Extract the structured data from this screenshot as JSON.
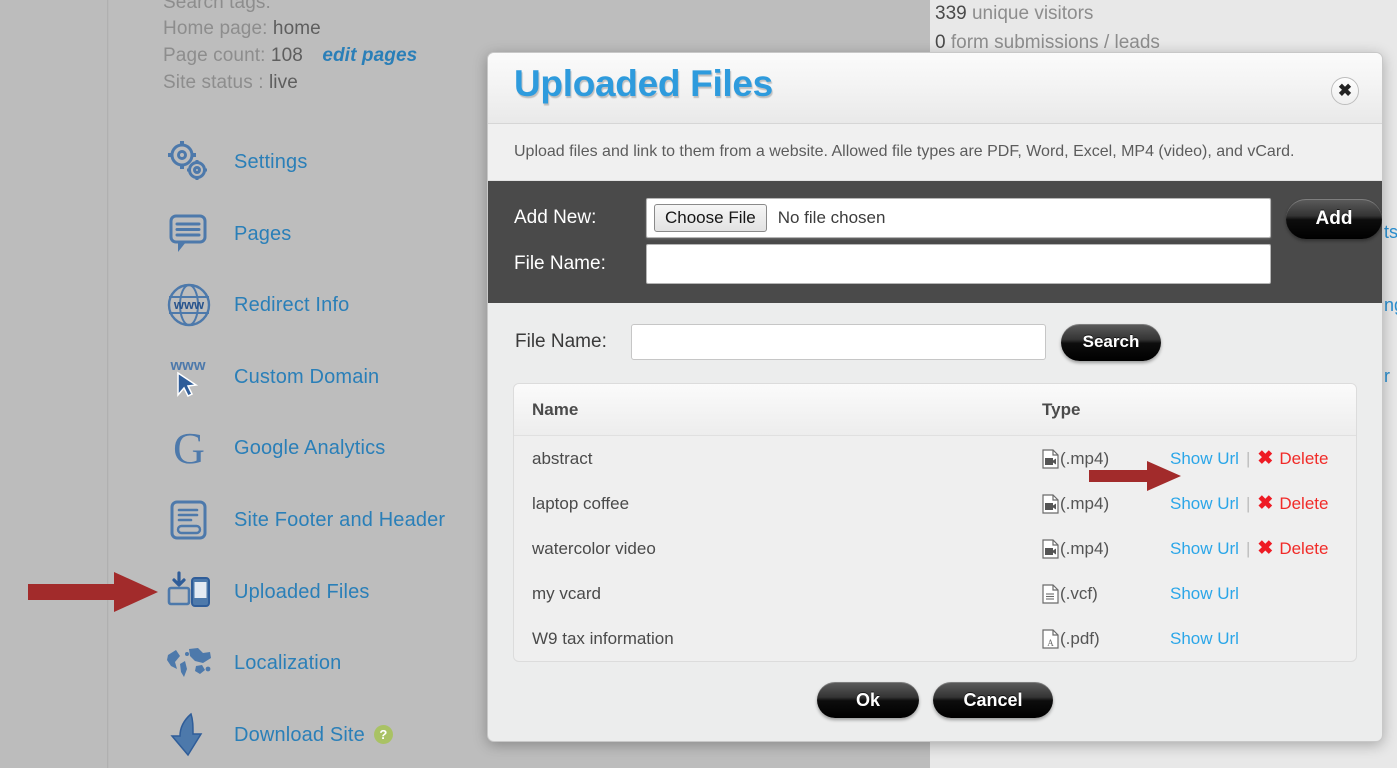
{
  "background": {
    "info_lines": [
      {
        "label": "Search tags:",
        "value": ""
      },
      {
        "label": "Home page:",
        "value": "home"
      },
      {
        "label": "Page count:",
        "value": "108",
        "link": "edit pages"
      },
      {
        "label": "Site status :",
        "value": "live"
      }
    ],
    "nav_items": [
      {
        "label": "Settings",
        "icon": "gears-icon"
      },
      {
        "label": "Pages",
        "icon": "pages-speech-icon"
      },
      {
        "label": "Redirect Info",
        "icon": "globe-www-icon"
      },
      {
        "label": "Custom Domain",
        "icon": "www-cursor-icon"
      },
      {
        "label": "Google Analytics",
        "icon": "google-g-icon"
      },
      {
        "label": "Site Footer and Header",
        "icon": "document-layout-icon"
      },
      {
        "label": "Uploaded Files",
        "icon": "upload-device-icon"
      },
      {
        "label": "Localization",
        "icon": "world-map-icon"
      },
      {
        "label": "Download Site",
        "icon": "download-arrow-icon",
        "help": "?"
      }
    ],
    "stats": [
      {
        "num": "339",
        "text": "unique visitors"
      },
      {
        "num": "0",
        "text": "form submissions / leads"
      }
    ],
    "clipped_right_text": [
      "ts",
      "ng",
      "r"
    ]
  },
  "modal": {
    "title": "Uploaded Files",
    "close_label": "✖",
    "description": "Upload files and link to them from a website. Allowed file types are PDF, Word, Excel, MP4 (video), and vCard.",
    "add_new": {
      "file_label": "Add New:",
      "choose_file_button": "Choose File",
      "no_file_text": "No file chosen",
      "file_name_label": "File Name:",
      "file_name_value": "",
      "file_name_placeholder": "",
      "add_button": "Add"
    },
    "search": {
      "label": "File Name:",
      "value": "",
      "placeholder": "",
      "button": "Search"
    },
    "table": {
      "headers": [
        "Name",
        "Type"
      ],
      "rows": [
        {
          "name": "abstract",
          "type": "(.mp4)",
          "icon": "video-file-icon",
          "show_url": "Show Url",
          "delete": "Delete",
          "has_delete": true
        },
        {
          "name": "laptop coffee",
          "type": "(.mp4)",
          "icon": "video-file-icon",
          "show_url": "Show Url",
          "delete": "Delete",
          "has_delete": true
        },
        {
          "name": "watercolor video",
          "type": "(.mp4)",
          "icon": "video-file-icon",
          "show_url": "Show Url",
          "delete": "Delete",
          "has_delete": true
        },
        {
          "name": "my vcard",
          "type": "(.vcf)",
          "icon": "text-file-icon",
          "show_url": "Show Url",
          "delete": "",
          "has_delete": false
        },
        {
          "name": "W9 tax information",
          "type": "(.pdf)",
          "icon": "pdf-file-icon",
          "show_url": "Show Url",
          "delete": "",
          "has_delete": false
        }
      ]
    },
    "footer": {
      "ok": "Ok",
      "cancel": "Cancel"
    }
  },
  "annotations": {
    "arrow_color": "#a22b2b",
    "arrows": [
      "sidebar-uploaded-files-arrow",
      "show-url-row-arrow"
    ]
  },
  "colors": {
    "title_blue": "#2e9bdd",
    "link_blue": "#2a7fb8",
    "show_url_blue": "#2ba6e8",
    "delete_red": "#f12b28",
    "panel_dark": "#4a4a4a",
    "page_bg": "#bdbdbd"
  }
}
